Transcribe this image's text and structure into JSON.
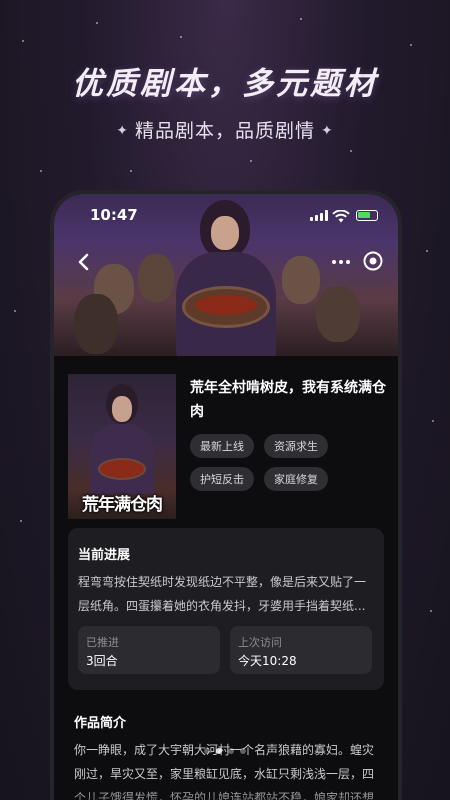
{
  "promo": {
    "title": "优质剧本，多元题材",
    "subtitle": "精品剧本，品质剧情",
    "spark_left": "✦",
    "spark_right": "✦"
  },
  "statusbar": {
    "time": "10:47",
    "icons": [
      "signal-icon",
      "wifi-icon",
      "battery-charging-icon"
    ]
  },
  "header": {
    "icons": [
      "back-chevron-icon",
      "more-dots-icon",
      "target-icon"
    ]
  },
  "book": {
    "title": "荒年全村啃树皮，我有系统满仓肉",
    "cover_text": "荒年满仓肉",
    "tags": [
      "最新上线",
      "资源求生",
      "护短反击",
      "家庭修复"
    ]
  },
  "progress": {
    "title": "当前进展",
    "text": "程弯弯按住契纸时发现纸边不平整，像是后来又贴了一层纸角。四蛋攥着她的衣角发抖，牙婆用手挡着契纸...",
    "pushed_label": "已推进",
    "pushed_value": "3回合",
    "last_visit_label": "上次访问",
    "last_visit_value": "今天10:28"
  },
  "intro": {
    "title": "作品简介",
    "text": "你一睁眼，成了大宇朝大河村一个名声狼藉的寡妇。蝗灾刚过，旱灾又至，家里粮缸见底，水缸只剩浅浅一层，四个儿子饿得发慌，怀孕的儿媳连站都站不稳，娘家却还想借者道"
  },
  "pager": {
    "count": 4,
    "active_index": 1
  },
  "colors": {
    "background": "#1c1722",
    "card": "#1e1e22",
    "tag": "#2e2e33",
    "battery": "#4cd964"
  }
}
